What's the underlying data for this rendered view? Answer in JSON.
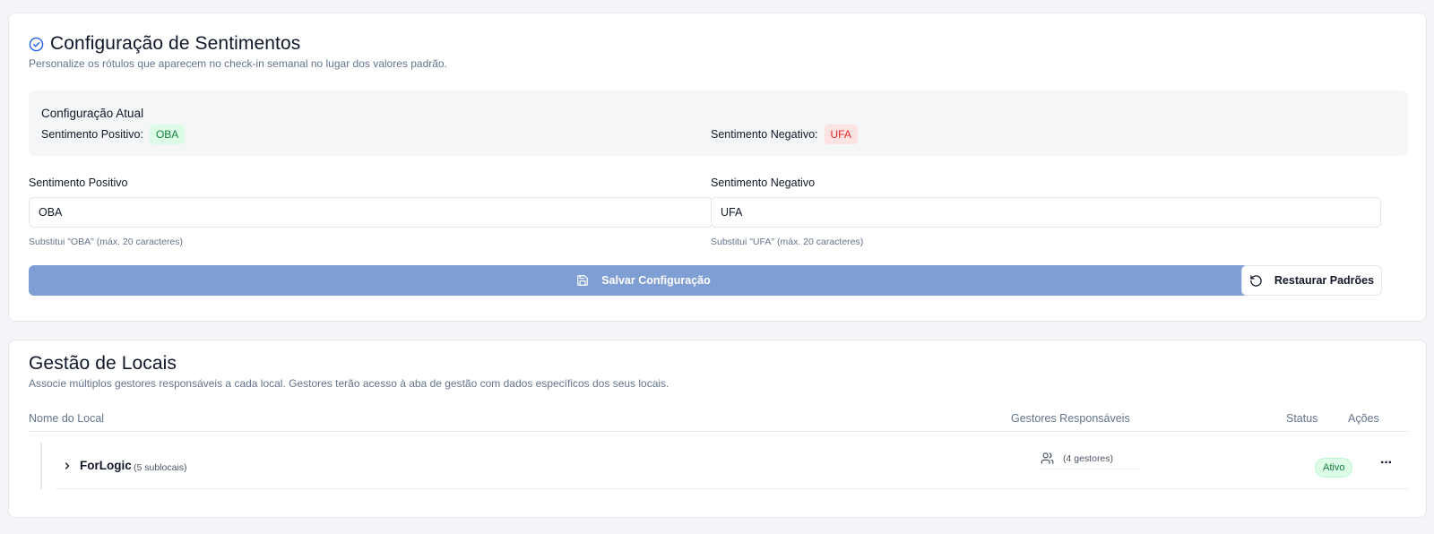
{
  "sentiment": {
    "title": "Configuração de Sentimentos",
    "subtitle": "Personalize os rótulos que aparecem no check-in semanal no lugar dos valores padrão.",
    "current": {
      "title": "Configuração Atual",
      "positive_label": "Sentimento Positivo:",
      "positive_value": "OBA",
      "negative_label": "Sentimento Negativo:",
      "negative_value": "UFA"
    },
    "positive_field": {
      "label": "Sentimento Positivo",
      "value": "OBA",
      "hint": "Substitui \"OBA\" (máx. 20 caracteres)"
    },
    "negative_field": {
      "label": "Sentimento Negativo",
      "value": "UFA",
      "hint": "Substitui \"UFA\" (máx. 20 caracteres)"
    },
    "save_label": "Salvar Configuração",
    "restore_label": "Restaurar Padrões"
  },
  "locations": {
    "title": "Gestão de Locais",
    "subtitle": "Associe múltiplos gestores responsáveis a cada local. Gestores terão acesso à aba de gestão com dados específicos dos seus locais.",
    "columns": [
      "Nome do Local",
      "Gestores Responsáveis",
      "Status",
      "Ações"
    ],
    "rows": [
      {
        "name": "ForLogic",
        "sublocations": "(5 sublocais)",
        "managers": "(4 gestores)",
        "status": "Ativo",
        "actions": "···"
      }
    ]
  },
  "colors": {
    "accent": "#2563eb",
    "save_button": "#7f9fd4",
    "positive_bg": "#dcfce7",
    "positive_text": "#15803d",
    "negative_bg": "#fde2e2",
    "negative_text": "#dc2626"
  },
  "icons": {
    "title": "circle-check-icon",
    "save": "save-icon",
    "restore": "rotate-ccw-icon",
    "expand": "chevron-right-icon",
    "managers": "users-icon",
    "more": "more-horizontal-icon"
  }
}
